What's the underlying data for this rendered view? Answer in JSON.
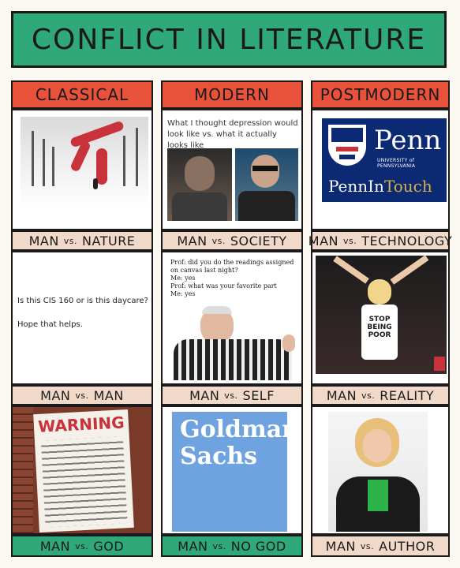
{
  "title": "CONFLICT IN LITERATURE",
  "columns": [
    "CLASSICAL",
    "MODERN",
    "POSTMODERN"
  ],
  "cells": [
    {
      "left": "MAN",
      "vs": "vs.",
      "right": "NATURE"
    },
    {
      "left": "MAN",
      "vs": "vs.",
      "right": "SOCIETY"
    },
    {
      "left": "MAN",
      "vs": "vs.",
      "right": "TECHNOLOGY"
    },
    {
      "left": "MAN",
      "vs": "vs.",
      "right": "MAN"
    },
    {
      "left": "MAN",
      "vs": "vs.",
      "right": "SELF"
    },
    {
      "left": "MAN",
      "vs": "vs.",
      "right": "REALITY"
    },
    {
      "left": "MAN",
      "vs": "vs.",
      "right": "GOD"
    },
    {
      "left": "MAN",
      "vs": "vs.",
      "right": "NO GOD"
    },
    {
      "left": "MAN",
      "vs": "vs.",
      "right": "AUTHOR"
    }
  ],
  "depression_meme": "What I thought depression would look like vs. what it actually looks like",
  "penn": {
    "name": "Penn",
    "sub": "UNIVERSITY of PENNSYLVANIA",
    "touch_a": "PennIn",
    "touch_b": "Touch"
  },
  "daycare": {
    "line1": "Is this CIS 160 or is this daycare?",
    "line2": "Hope that helps."
  },
  "prof_meme": {
    "l1": "Prof: did you do the readings assigned on canvas last night?",
    "l2": "Me: yes",
    "l3": "Prof: what was your favorite part",
    "l4": "Me: yes"
  },
  "shirt": {
    "l1": "STOP",
    "l2": "BEING",
    "l3": "POOR"
  },
  "sign_word": "WARNING",
  "gs": {
    "l1": "Goldman",
    "l2": "Sachs"
  },
  "colors": {
    "green": "#2fa87a",
    "red": "#e8523a",
    "tan": "#f1d9c9",
    "penn_blue": "#0c2a74",
    "gs_blue": "#6fa3df"
  }
}
